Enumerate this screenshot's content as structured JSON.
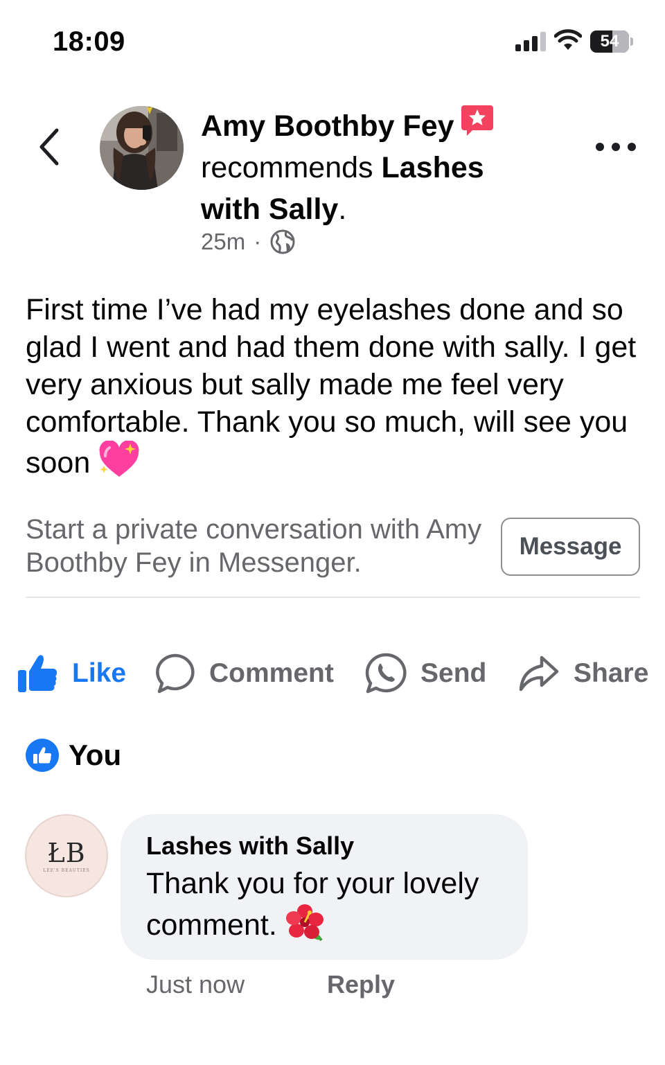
{
  "status_bar": {
    "time": "18:09",
    "battery_level": "54"
  },
  "post": {
    "author": "Amy Boothby Fey",
    "recommends_text": "recommends",
    "page_name_part1": "Lashes",
    "page_name_part2": "with Sally",
    "period": ".",
    "time": "25m",
    "separator": "·",
    "body": "First time I’ve had my eyelashes done and so glad I went and had them done with sally. I get very anxious but sally made me feel very comfortable. Thank you so much, will see you soon",
    "body_emoji": "💖"
  },
  "messenger_prompt": {
    "text": "Start a private conversation with Amy Boothby Fey in Messenger.",
    "button_label": "Message"
  },
  "actions": {
    "like": "Like",
    "comment": "Comment",
    "send": "Send",
    "share": "Share"
  },
  "likes": {
    "text": "You"
  },
  "comment": {
    "avatar_logo": "ŁB",
    "avatar_logo_sub": "LEE'S BEAUTIES",
    "author": "Lashes with Sally",
    "text": "Thank you for your lovely comment.",
    "emoji": "🌺",
    "time": "Just now",
    "reply_label": "Reply"
  },
  "colors": {
    "brand_blue": "#1877f2",
    "secondary_text": "#65676b",
    "bubble_bg": "#f0f2f5",
    "badge_red": "#f3425f"
  },
  "icons": [
    "back-chevron-icon",
    "recommendation-badge-icon",
    "globe-icon",
    "more-options-icon",
    "thumbs-up-icon",
    "comment-icon",
    "messenger-icon",
    "share-icon"
  ]
}
